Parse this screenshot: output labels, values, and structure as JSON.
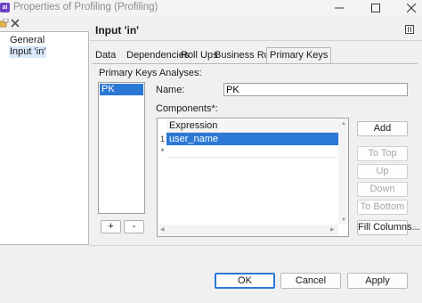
{
  "window": {
    "title": "Properties of Profiling (Profiling)",
    "app_icon_text": "ai"
  },
  "tree": {
    "items": [
      {
        "label": "General"
      },
      {
        "label": "Input 'in'"
      }
    ]
  },
  "header": {
    "title": "Input 'in'"
  },
  "tabs": [
    {
      "label": "Data"
    },
    {
      "label": "Dependencies"
    },
    {
      "label": "Roll Ups"
    },
    {
      "label": "Business Rules"
    },
    {
      "label": "Primary Keys"
    }
  ],
  "primary_keys": {
    "section_label": "Primary Keys Analyses:",
    "list": [
      "PK"
    ],
    "add_label": "+",
    "remove_label": "-",
    "name_label": "Name:",
    "name_value": "PK",
    "components_label": "Components*:",
    "table": {
      "column": "Expression",
      "rows": [
        {
          "gutter": "1",
          "value": "user_name"
        },
        {
          "gutter": "*",
          "value": ""
        }
      ]
    },
    "buttons": {
      "add": "Add",
      "to_top": "To Top",
      "up": "Up",
      "down": "Down",
      "to_bottom": "To Bottom",
      "fill_columns": "Fill Columns..."
    }
  },
  "dialog_buttons": {
    "ok": "OK",
    "cancel": "Cancel",
    "apply": "Apply"
  },
  "colors": {
    "selection": "#2b78d6",
    "tree_selection": "#d9e8fb",
    "app_icon": "#6b3fc4"
  }
}
